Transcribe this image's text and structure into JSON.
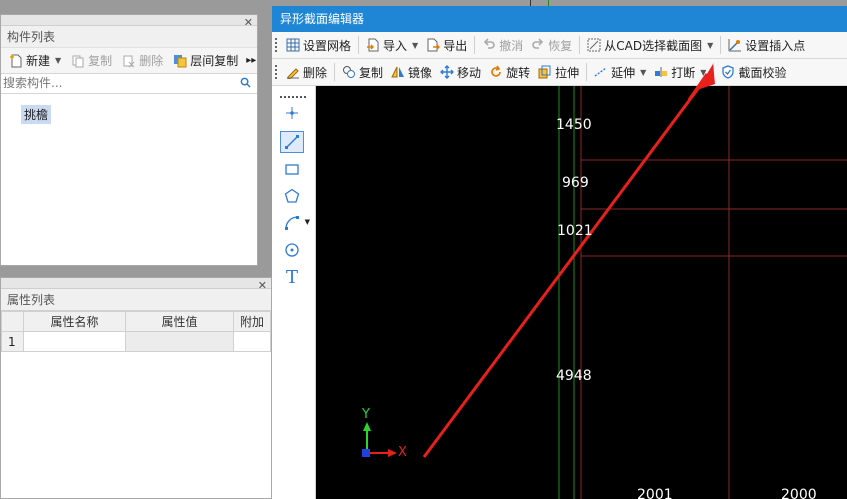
{
  "component_panel": {
    "title": "构件列表",
    "toolbar": {
      "new": "新建",
      "copy": "复制",
      "delete": "删除",
      "floor_copy": "层间复制"
    },
    "search_placeholder": "搜索构件...",
    "items": [
      "挑檐"
    ]
  },
  "property_panel": {
    "title": "属性列表",
    "columns": [
      "属性名称",
      "属性值",
      "附加"
    ],
    "rows": [
      {
        "index": "1",
        "name": "",
        "value": "",
        "extra": ""
      }
    ]
  },
  "editor": {
    "title": "异形截面编辑器",
    "toolbar1": {
      "grid": "设置网格",
      "import": "导入",
      "export": "导出",
      "undo": "撤消",
      "redo": "恢复",
      "from_cad": "从CAD选择截面图",
      "insert_point": "设置插入点"
    },
    "toolbar2": {
      "delete": "删除",
      "copy": "复制",
      "mirror": "镜像",
      "move": "移动",
      "rotate": "旋转",
      "stretch": "拉伸",
      "extend": "延伸",
      "break": "打断",
      "verify": "截面校验"
    },
    "canvas": {
      "dimensions": [
        "1450",
        "969",
        "1021",
        "4948",
        "2001",
        "2000"
      ],
      "axis_x": "X",
      "axis_y": "Y"
    }
  },
  "colors": {
    "title_blue": "#1f86d6",
    "canvas_bg": "#000000",
    "grid_red": "#8a2a2a",
    "arrow_red": "#e8201c",
    "green_line": "#1e8a1e"
  }
}
